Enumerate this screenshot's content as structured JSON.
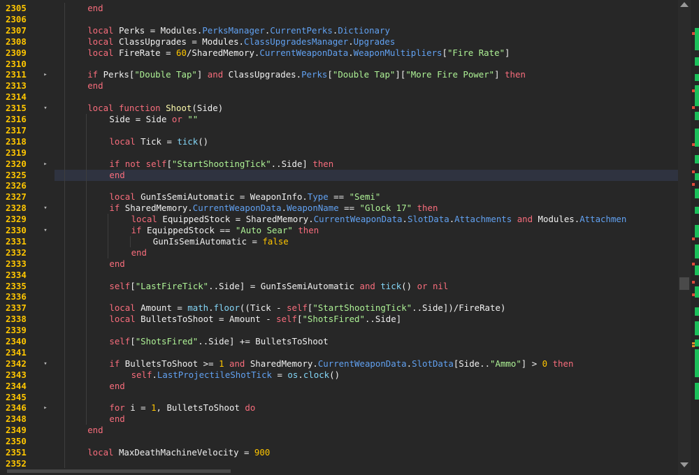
{
  "gutter": [
    {
      "n": "2305",
      "f": ""
    },
    {
      "n": "2306",
      "f": ""
    },
    {
      "n": "2307",
      "f": ""
    },
    {
      "n": "2308",
      "f": ""
    },
    {
      "n": "2309",
      "f": ""
    },
    {
      "n": "2310",
      "f": ""
    },
    {
      "n": "2311",
      "f": "▸"
    },
    {
      "n": "2313",
      "f": ""
    },
    {
      "n": "2314",
      "f": ""
    },
    {
      "n": "2315",
      "f": "▾"
    },
    {
      "n": "2316",
      "f": ""
    },
    {
      "n": "2317",
      "f": ""
    },
    {
      "n": "2318",
      "f": ""
    },
    {
      "n": "2319",
      "f": ""
    },
    {
      "n": "2320",
      "f": "▸"
    },
    {
      "n": "2325",
      "f": ""
    },
    {
      "n": "2326",
      "f": ""
    },
    {
      "n": "2327",
      "f": ""
    },
    {
      "n": "2328",
      "f": "▾"
    },
    {
      "n": "2329",
      "f": ""
    },
    {
      "n": "2330",
      "f": "▾"
    },
    {
      "n": "2331",
      "f": ""
    },
    {
      "n": "2332",
      "f": ""
    },
    {
      "n": "2333",
      "f": ""
    },
    {
      "n": "2334",
      "f": ""
    },
    {
      "n": "2335",
      "f": ""
    },
    {
      "n": "2336",
      "f": ""
    },
    {
      "n": "2337",
      "f": ""
    },
    {
      "n": "2338",
      "f": ""
    },
    {
      "n": "2339",
      "f": ""
    },
    {
      "n": "2340",
      "f": ""
    },
    {
      "n": "2341",
      "f": ""
    },
    {
      "n": "2342",
      "f": "▾"
    },
    {
      "n": "2343",
      "f": ""
    },
    {
      "n": "2344",
      "f": ""
    },
    {
      "n": "2345",
      "f": ""
    },
    {
      "n": "2346",
      "f": "▸"
    },
    {
      "n": "2348",
      "f": ""
    },
    {
      "n": "2349",
      "f": ""
    },
    {
      "n": "2350",
      "f": ""
    },
    {
      "n": "2351",
      "f": ""
    },
    {
      "n": "2352",
      "f": ""
    }
  ],
  "lines": [
    {
      "i": 4,
      "t": [
        [
          "kw",
          "end"
        ]
      ]
    },
    {
      "i": 0,
      "t": []
    },
    {
      "i": 4,
      "t": [
        [
          "kw",
          "local "
        ],
        [
          "id",
          "Perks = Modules."
        ],
        [
          "prop",
          "PerksManager"
        ],
        [
          "id",
          "."
        ],
        [
          "prop",
          "CurrentPerks"
        ],
        [
          "id",
          "."
        ],
        [
          "prop",
          "Dictionary"
        ]
      ]
    },
    {
      "i": 4,
      "t": [
        [
          "kw",
          "local "
        ],
        [
          "id",
          "ClassUpgrades = Modules."
        ],
        [
          "prop",
          "ClassUpgradesManager"
        ],
        [
          "id",
          "."
        ],
        [
          "prop",
          "Upgrades"
        ]
      ]
    },
    {
      "i": 4,
      "t": [
        [
          "kw",
          "local "
        ],
        [
          "id",
          "FireRate = "
        ],
        [
          "num",
          "60"
        ],
        [
          "id",
          "/SharedMemory."
        ],
        [
          "prop",
          "CurrentWeaponData"
        ],
        [
          "id",
          "."
        ],
        [
          "prop",
          "WeaponMultipliers"
        ],
        [
          "id",
          "["
        ],
        [
          "str",
          "\"Fire Rate\""
        ],
        [
          "id",
          "]"
        ]
      ]
    },
    {
      "i": 0,
      "t": []
    },
    {
      "i": 4,
      "t": [
        [
          "kw",
          "if "
        ],
        [
          "id",
          "Perks["
        ],
        [
          "str",
          "\"Double Tap\""
        ],
        [
          "id",
          "] "
        ],
        [
          "kw",
          "and "
        ],
        [
          "id",
          "ClassUpgrades."
        ],
        [
          "prop",
          "Perks"
        ],
        [
          "id",
          "["
        ],
        [
          "str",
          "\"Double Tap\""
        ],
        [
          "id",
          "]["
        ],
        [
          "str",
          "\"More Fire Power\""
        ],
        [
          "id",
          "] "
        ],
        [
          "kw",
          "then"
        ]
      ]
    },
    {
      "i": 4,
      "t": [
        [
          "kw",
          "end"
        ]
      ]
    },
    {
      "i": 0,
      "t": []
    },
    {
      "i": 4,
      "t": [
        [
          "kw",
          "local function "
        ],
        [
          "fn",
          "Shoot"
        ],
        [
          "id",
          "(Side)"
        ]
      ]
    },
    {
      "i": 8,
      "t": [
        [
          "id",
          "Side = Side "
        ],
        [
          "kw",
          "or "
        ],
        [
          "str",
          "\"\""
        ]
      ]
    },
    {
      "i": 0,
      "t": []
    },
    {
      "i": 8,
      "t": [
        [
          "kw",
          "local "
        ],
        [
          "id",
          "Tick = "
        ],
        [
          "bi",
          "tick"
        ],
        [
          "id",
          "()"
        ]
      ]
    },
    {
      "i": 0,
      "t": []
    },
    {
      "i": 8,
      "t": [
        [
          "kw",
          "if not "
        ],
        [
          "sf",
          "self"
        ],
        [
          "id",
          "["
        ],
        [
          "str",
          "\"StartShootingTick\""
        ],
        [
          "id",
          "..Side] "
        ],
        [
          "kw",
          "then"
        ]
      ]
    },
    {
      "i": 8,
      "t": [
        [
          "kw",
          "end"
        ]
      ],
      "hl": true
    },
    {
      "i": 0,
      "t": []
    },
    {
      "i": 8,
      "t": [
        [
          "kw",
          "local "
        ],
        [
          "id",
          "GunIsSemiAutomatic = WeaponInfo."
        ],
        [
          "prop",
          "Type"
        ],
        [
          "id",
          " == "
        ],
        [
          "str",
          "\"Semi\""
        ]
      ]
    },
    {
      "i": 8,
      "t": [
        [
          "kw",
          "if "
        ],
        [
          "id",
          "SharedMemory."
        ],
        [
          "prop",
          "CurrentWeaponData"
        ],
        [
          "id",
          "."
        ],
        [
          "prop",
          "WeaponName"
        ],
        [
          "id",
          " == "
        ],
        [
          "str",
          "\"Glock 17\""
        ],
        [
          "id",
          " "
        ],
        [
          "kw",
          "then"
        ]
      ]
    },
    {
      "i": 12,
      "t": [
        [
          "kw",
          "local "
        ],
        [
          "id",
          "EquippedStock = SharedMemory."
        ],
        [
          "prop",
          "CurrentWeaponData"
        ],
        [
          "id",
          "."
        ],
        [
          "prop",
          "SlotData"
        ],
        [
          "id",
          "."
        ],
        [
          "prop",
          "Attachments"
        ],
        [
          "id",
          " "
        ],
        [
          "kw",
          "and "
        ],
        [
          "id",
          "Modules."
        ],
        [
          "prop",
          "Attachmen"
        ]
      ]
    },
    {
      "i": 12,
      "t": [
        [
          "kw",
          "if "
        ],
        [
          "id",
          "EquippedStock == "
        ],
        [
          "str",
          "\"Auto Sear\""
        ],
        [
          "id",
          " "
        ],
        [
          "kw",
          "then"
        ]
      ]
    },
    {
      "i": 16,
      "t": [
        [
          "id",
          "GunIsSemiAutomatic = "
        ],
        [
          "num",
          "false"
        ]
      ]
    },
    {
      "i": 12,
      "t": [
        [
          "kw",
          "end"
        ]
      ]
    },
    {
      "i": 8,
      "t": [
        [
          "kw",
          "end"
        ]
      ]
    },
    {
      "i": 0,
      "t": []
    },
    {
      "i": 8,
      "t": [
        [
          "sf",
          "self"
        ],
        [
          "id",
          "["
        ],
        [
          "str",
          "\"LastFireTick\""
        ],
        [
          "id",
          "..Side] = GunIsSemiAutomatic "
        ],
        [
          "kw",
          "and "
        ],
        [
          "bi",
          "tick"
        ],
        [
          "id",
          "() "
        ],
        [
          "kw",
          "or "
        ],
        [
          "kw",
          "nil"
        ]
      ]
    },
    {
      "i": 0,
      "t": []
    },
    {
      "i": 8,
      "t": [
        [
          "kw",
          "local "
        ],
        [
          "id",
          "Amount = "
        ],
        [
          "bi",
          "math"
        ],
        [
          "id",
          "."
        ],
        [
          "bi",
          "floor"
        ],
        [
          "id",
          "((Tick - "
        ],
        [
          "sf",
          "self"
        ],
        [
          "id",
          "["
        ],
        [
          "str",
          "\"StartShootingTick\""
        ],
        [
          "id",
          "..Side])/FireRate)"
        ]
      ]
    },
    {
      "i": 8,
      "t": [
        [
          "kw",
          "local "
        ],
        [
          "id",
          "BulletsToShoot = Amount - "
        ],
        [
          "sf",
          "self"
        ],
        [
          "id",
          "["
        ],
        [
          "str",
          "\"ShotsFired\""
        ],
        [
          "id",
          "..Side]"
        ]
      ]
    },
    {
      "i": 0,
      "t": []
    },
    {
      "i": 8,
      "t": [
        [
          "sf",
          "self"
        ],
        [
          "id",
          "["
        ],
        [
          "str",
          "\"ShotsFired\""
        ],
        [
          "id",
          "..Side] += BulletsToShoot"
        ]
      ]
    },
    {
      "i": 0,
      "t": []
    },
    {
      "i": 8,
      "t": [
        [
          "kw",
          "if "
        ],
        [
          "id",
          "BulletsToShoot >= "
        ],
        [
          "num",
          "1"
        ],
        [
          "id",
          " "
        ],
        [
          "kw",
          "and "
        ],
        [
          "id",
          "SharedMemory."
        ],
        [
          "prop",
          "CurrentWeaponData"
        ],
        [
          "id",
          "."
        ],
        [
          "prop",
          "SlotData"
        ],
        [
          "id",
          "[Side.."
        ],
        [
          "str",
          "\"Ammo\""
        ],
        [
          "id",
          "] > "
        ],
        [
          "num",
          "0"
        ],
        [
          "id",
          " "
        ],
        [
          "kw",
          "then"
        ]
      ]
    },
    {
      "i": 12,
      "t": [
        [
          "sf",
          "self"
        ],
        [
          "id",
          "."
        ],
        [
          "prop",
          "LastProjectileShotTick"
        ],
        [
          "id",
          " = "
        ],
        [
          "bi",
          "os"
        ],
        [
          "id",
          "."
        ],
        [
          "bi",
          "clock"
        ],
        [
          "id",
          "()"
        ]
      ]
    },
    {
      "i": 8,
      "t": [
        [
          "kw",
          "end"
        ]
      ]
    },
    {
      "i": 0,
      "t": []
    },
    {
      "i": 8,
      "t": [
        [
          "kw",
          "for "
        ],
        [
          "id",
          "i = "
        ],
        [
          "num",
          "1"
        ],
        [
          "id",
          ", BulletsToShoot "
        ],
        [
          "kw",
          "do"
        ]
      ]
    },
    {
      "i": 8,
      "t": [
        [
          "kw",
          "end"
        ]
      ]
    },
    {
      "i": 4,
      "t": [
        [
          "kw",
          "end"
        ]
      ]
    },
    {
      "i": 0,
      "t": []
    },
    {
      "i": 4,
      "t": [
        [
          "kw",
          "local "
        ],
        [
          "id",
          "MaxDeathMachineVelocity = "
        ],
        [
          "num",
          "900"
        ]
      ]
    },
    {
      "i": 0,
      "t": []
    }
  ],
  "theme": {
    "background": "#272727",
    "keyword": "#f86d7c",
    "string": "#adf195",
    "number": "#ffc600",
    "property": "#61a1f1",
    "builtin": "#84d6f7",
    "function": "#fdfbac",
    "text": "#f0f0f0"
  }
}
